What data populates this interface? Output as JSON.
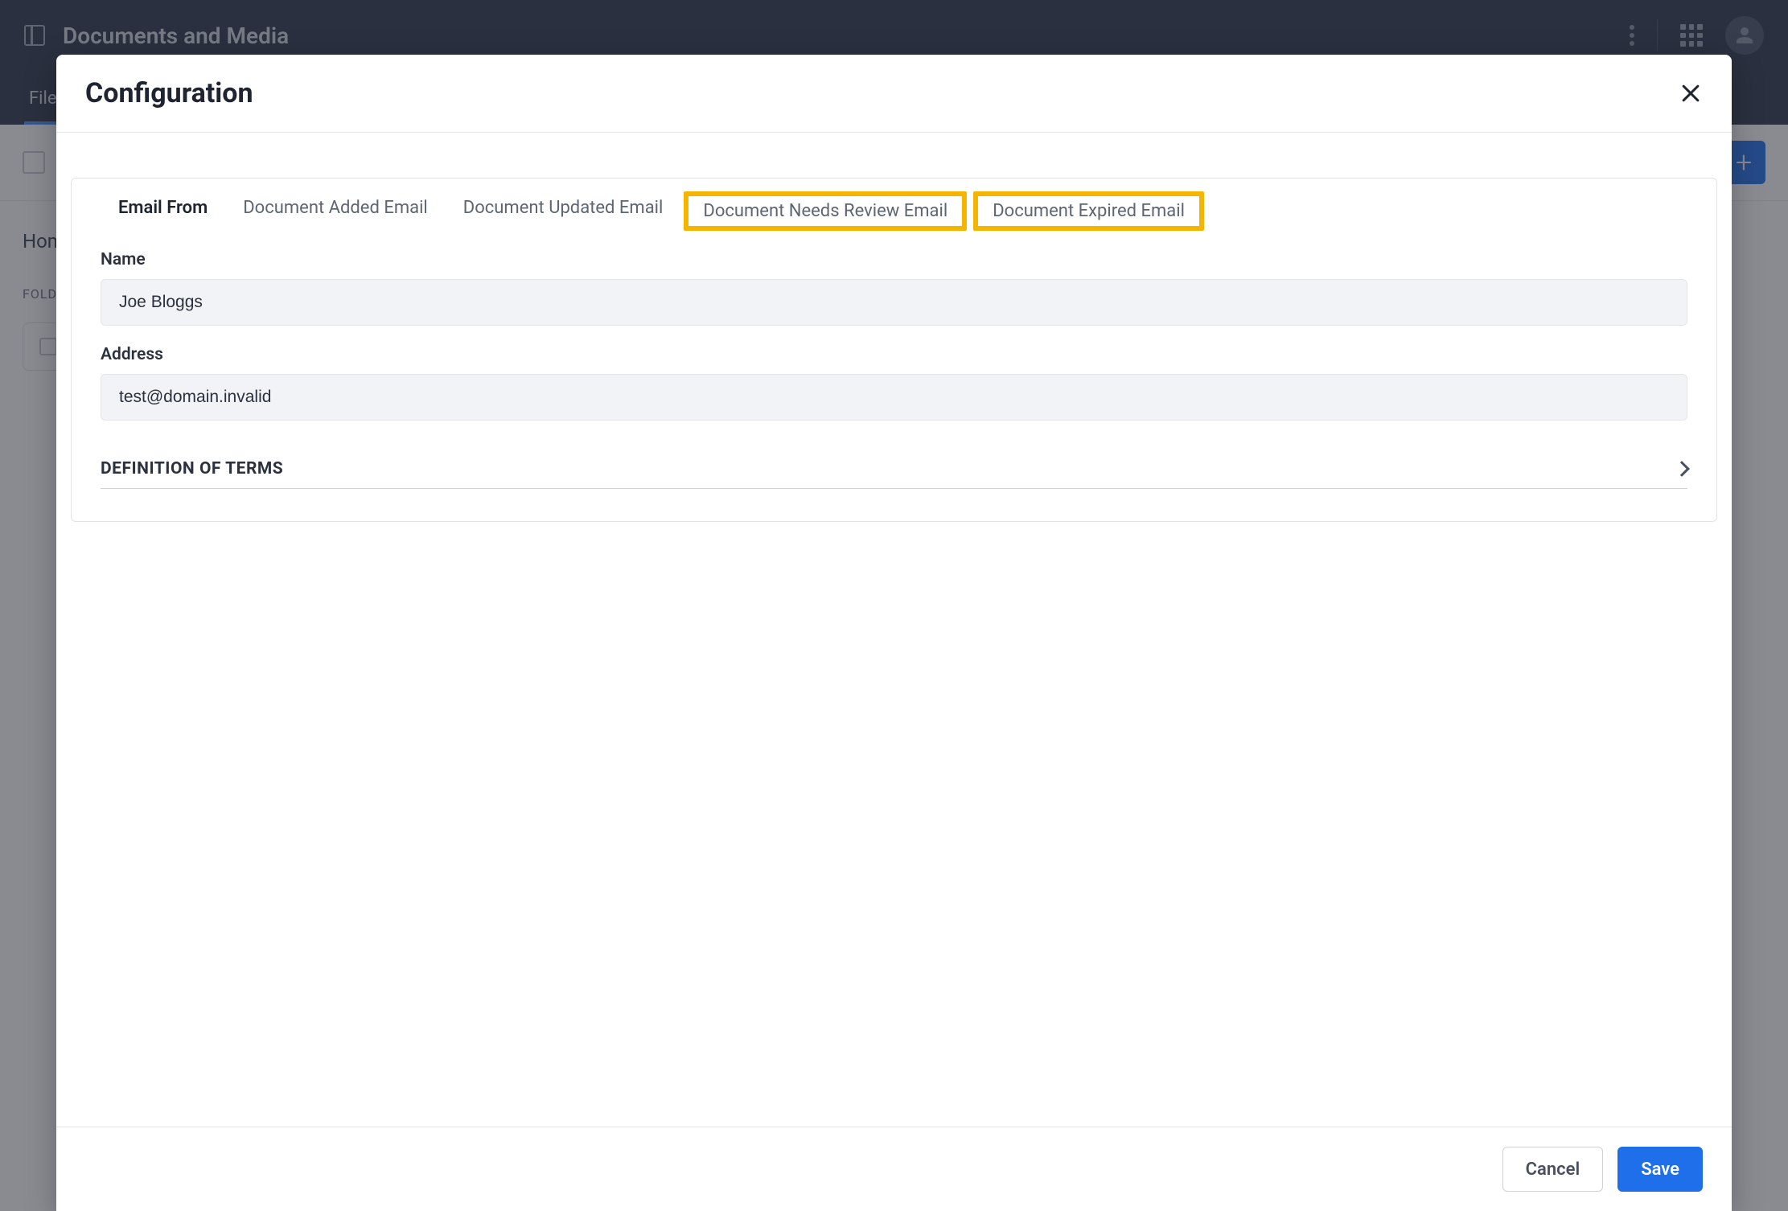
{
  "background": {
    "title": "Documents and Media",
    "tab": "Files",
    "breadcrumb": "Home",
    "folders_label": "FOLDERS"
  },
  "modal": {
    "title": "Configuration",
    "tabs": [
      {
        "label": "Email From",
        "active": true,
        "highlighted": false
      },
      {
        "label": "Document Added Email",
        "active": false,
        "highlighted": false
      },
      {
        "label": "Document Updated Email",
        "active": false,
        "highlighted": false
      },
      {
        "label": "Document Needs Review Email",
        "active": false,
        "highlighted": true
      },
      {
        "label": "Document Expired Email",
        "active": false,
        "highlighted": true
      }
    ],
    "fields": {
      "name": {
        "label": "Name",
        "value": "Joe Bloggs"
      },
      "address": {
        "label": "Address",
        "value": "test@domain.invalid"
      }
    },
    "collapsible": {
      "title": "DEFINITION OF TERMS"
    },
    "buttons": {
      "cancel": "Cancel",
      "save": "Save"
    }
  }
}
